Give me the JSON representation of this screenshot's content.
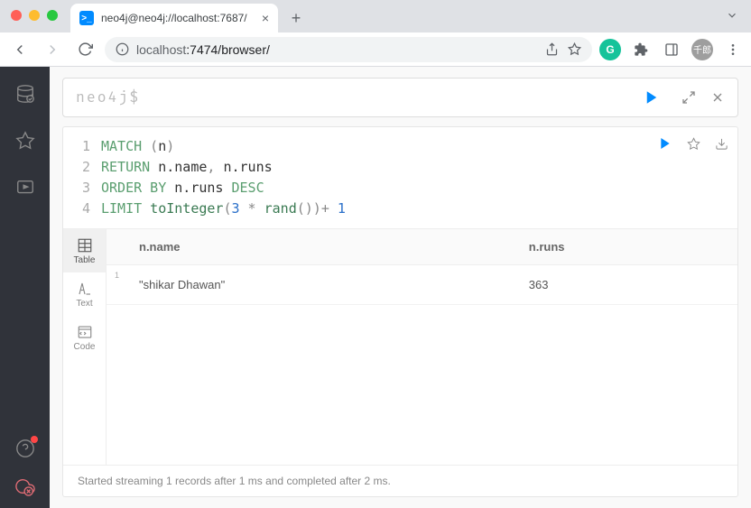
{
  "browser": {
    "tab_title": "neo4j@neo4j://localhost:7687/",
    "url_host": "localhost",
    "url_path": ":7474/browser/"
  },
  "prompt": {
    "label": "neo4j$"
  },
  "query": {
    "lines": [
      "1",
      "2",
      "3",
      "4"
    ],
    "tokens": [
      [
        [
          "kw",
          "MATCH"
        ],
        [
          "op",
          " ("
        ],
        [
          "id",
          "n"
        ],
        [
          "op",
          ")"
        ]
      ],
      [
        [
          "kw",
          "RETURN"
        ],
        [
          "id",
          " n.name"
        ],
        [
          "op",
          ", "
        ],
        [
          "id",
          "n.runs"
        ]
      ],
      [
        [
          "kw",
          "ORDER BY"
        ],
        [
          "id",
          " n.runs "
        ],
        [
          "kw",
          "DESC"
        ]
      ],
      [
        [
          "kw",
          "LIMIT"
        ],
        [
          "fn",
          " toInteger"
        ],
        [
          "op",
          "("
        ],
        [
          "num",
          "3"
        ],
        [
          "op",
          " * "
        ],
        [
          "fn",
          "rand"
        ],
        [
          "op",
          "())+ "
        ],
        [
          "num",
          "1"
        ]
      ]
    ]
  },
  "views": {
    "table": "Table",
    "text": "Text",
    "code": "Code"
  },
  "table": {
    "columns": [
      "n.name",
      "n.runs"
    ],
    "rows": [
      {
        "idx": "1",
        "cells": [
          "\"shikar Dhawan\"",
          "363"
        ]
      }
    ]
  },
  "footer": "Started streaming 1 records after 1 ms and completed after 2 ms."
}
